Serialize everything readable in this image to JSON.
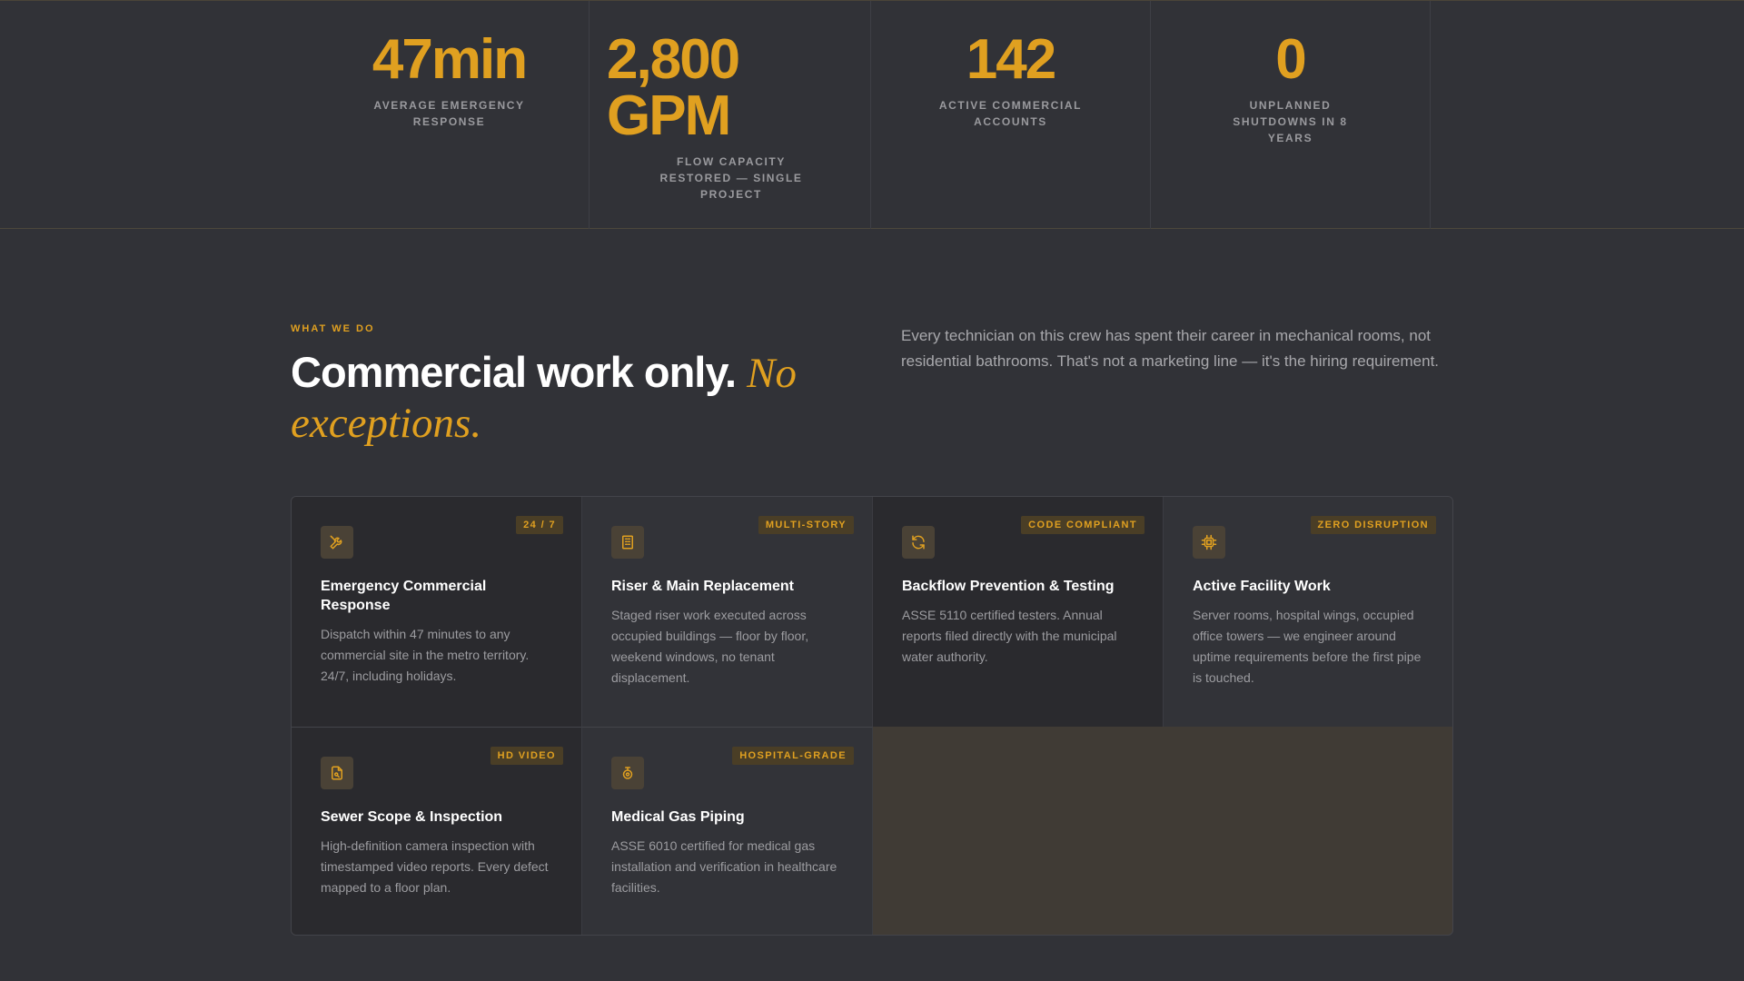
{
  "stats": [
    {
      "value": "47min",
      "label": "AVERAGE EMERGENCY RESPONSE"
    },
    {
      "value": "2,800 GPM",
      "label": "FLOW CAPACITY RESTORED — SINGLE PROJECT"
    },
    {
      "value": "142",
      "label": "ACTIVE COMMERCIAL ACCOUNTS"
    },
    {
      "value": "0",
      "label": "UNPLANNED SHUTDOWNS IN 8 YEARS"
    }
  ],
  "services": {
    "eyebrow": "WHAT WE DO",
    "headline": "Commercial work only.",
    "headline_accent": "No exceptions.",
    "intro": "Every technician on this crew has spent their career in mechanical rooms, not residential bathrooms. That's not a marketing line — it's the hiring requirement.",
    "cards": [
      {
        "badge": "24 / 7",
        "icon": "tools-icon",
        "title": "Emergency Commercial Response",
        "desc": "Dispatch within 47 minutes to any commercial site in the metro territory. 24/7, including holidays."
      },
      {
        "badge": "MULTI-STORY",
        "icon": "building-icon",
        "title": "Riser & Main Replacement",
        "desc": "Staged riser work executed across occupied buildings — floor by floor, weekend windows, no tenant displacement."
      },
      {
        "badge": "CODE COMPLIANT",
        "icon": "refresh-icon",
        "title": "Backflow Prevention & Testing",
        "desc": "ASSE 5110 certified testers. Annual reports filed directly with the municipal water authority."
      },
      {
        "badge": "ZERO DISRUPTION",
        "icon": "chip-icon",
        "title": "Active Facility Work",
        "desc": "Server rooms, hospital wings, occupied office towers — we engineer around uptime requirements before the first pipe is touched."
      },
      {
        "badge": "HD VIDEO",
        "icon": "document-icon",
        "title": "Sewer Scope & Inspection",
        "desc": "High-definition camera inspection with timestamped video reports. Every defect mapped to a floor plan."
      },
      {
        "badge": "HOSPITAL-GRADE",
        "icon": "gas-valve-icon",
        "title": "Medical Gas Piping",
        "desc": "ASSE 6010 certified for medical gas installation and verification in healthcare facilities."
      }
    ]
  },
  "colors": {
    "accent": "#e0a020",
    "background": "#313237",
    "card_dark": "#2a2a2e",
    "card_mid": "#323338",
    "empty_cell": "#403b35"
  }
}
